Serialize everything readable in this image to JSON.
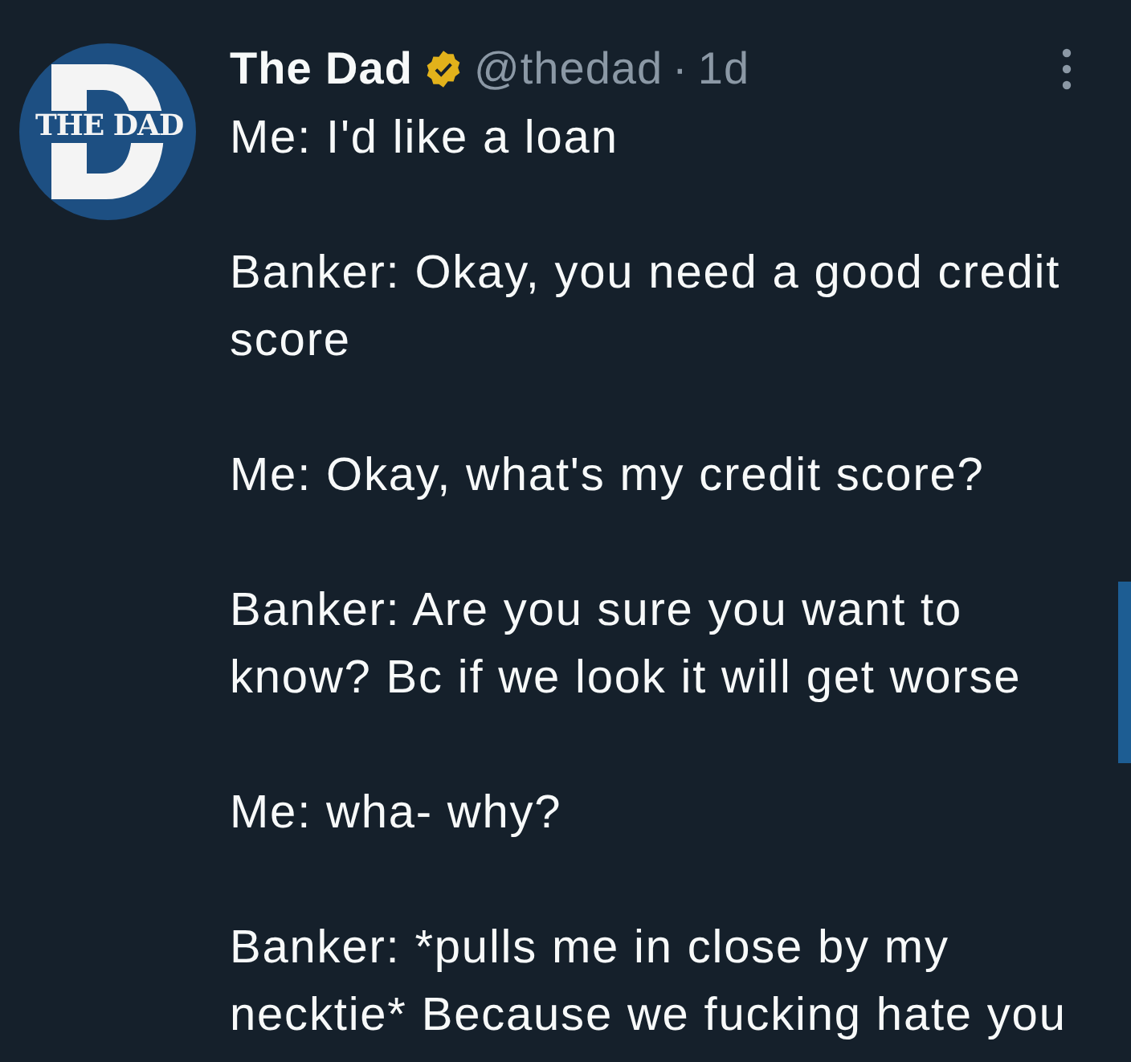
{
  "tweet": {
    "avatar": {
      "label": "THE DAD"
    },
    "author": {
      "name": "The Dad",
      "verified": true,
      "handle": "@thedad",
      "separator": "·",
      "time": "1d"
    },
    "paragraphs": [
      "Me: I'd like a loan",
      "Banker: Okay, you need a good credit score",
      "Me: Okay, what's my credit score?",
      "Banker: Are you sure you want to know? Bc if we look it will get worse",
      "Me: wha- why?",
      "Banker: *pulls me in close by my necktie* Because we fucking hate you"
    ]
  }
}
